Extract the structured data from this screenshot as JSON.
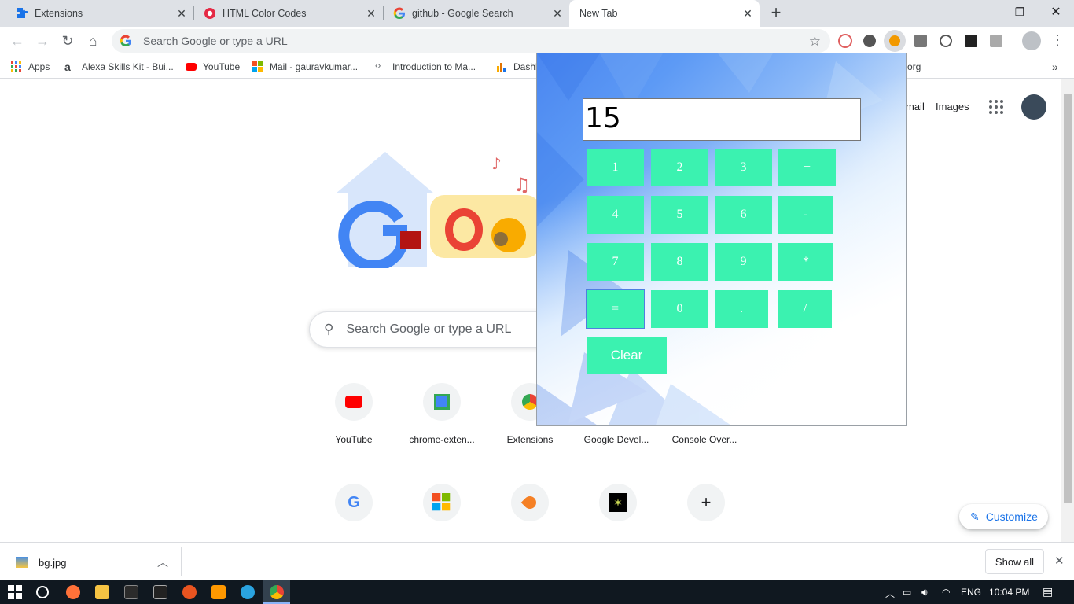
{
  "tabs": [
    {
      "title": "Extensions",
      "icon": "puzzle-icon"
    },
    {
      "title": "HTML Color Codes",
      "icon": "color-wheel-icon"
    },
    {
      "title": "github - Google Search",
      "icon": "google-icon"
    },
    {
      "title": "New Tab",
      "icon": "none"
    }
  ],
  "toolbar": {
    "omnibox_placeholder": "Search Google or type a URL"
  },
  "bookmarks": [
    {
      "label": "Apps"
    },
    {
      "label": "Alexa Skills Kit - Bui..."
    },
    {
      "label": "YouTube"
    },
    {
      "label": "Mail - gauravkumar..."
    },
    {
      "label": "Introduction to Ma..."
    },
    {
      "label": "Dashb"
    },
    {
      "label": "org"
    }
  ],
  "ntp": {
    "header_links": [
      "mail",
      "Images"
    ],
    "search_placeholder": "Search Google or type a URL",
    "shortcuts": [
      {
        "label": "YouTube"
      },
      {
        "label": "chrome-exten..."
      },
      {
        "label": "Extensions"
      },
      {
        "label": "Google Devel..."
      },
      {
        "label": "Console Over..."
      }
    ],
    "customize_label": "Customize"
  },
  "calculator": {
    "display_value": "15",
    "keys": [
      "1",
      "2",
      "3",
      "+",
      "4",
      "5",
      "6",
      "-",
      "7",
      "8",
      "9",
      "*",
      "=",
      "0",
      ".",
      "/"
    ],
    "clear_label": "Clear"
  },
  "downloads": {
    "file": "bg.jpg",
    "show_all": "Show all"
  },
  "taskbar": {
    "language": "ENG",
    "time": "10:04 PM"
  },
  "colors": {
    "key_bg": "#3bf2b0",
    "accent": "#1a73e8"
  }
}
